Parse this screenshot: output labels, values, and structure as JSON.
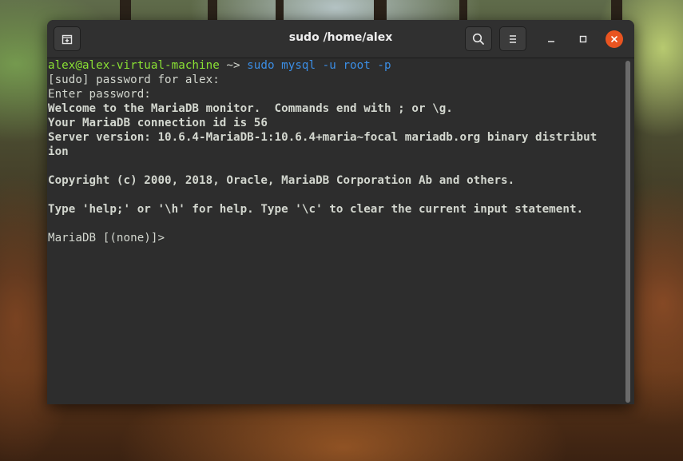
{
  "window": {
    "title": "sudo /home/alex"
  },
  "icons": {
    "new_tab": "new-tab-icon",
    "search": "search-icon",
    "menu": "hamburger-menu-icon",
    "minimize": "minimize-icon",
    "maximize": "maximize-icon",
    "close": "close-icon"
  },
  "colors": {
    "prompt_user": "#8ae234",
    "command": "#3b8ee5",
    "close_button": "#e95420",
    "terminal_bg": "#2d2d2d"
  },
  "terminal": {
    "prompt_user": "alex@alex-virtual-machine",
    "prompt_path": " ~> ",
    "command": "sudo mysql -u root -p",
    "lines": [
      "[sudo] password for alex:",
      "Enter password:",
      "Welcome to the MariaDB monitor.  Commands end with ; or \\g.",
      "Your MariaDB connection id is 56",
      "Server version: 10.6.4-MariaDB-1:10.6.4+maria~focal mariadb.org binary distribut",
      "ion",
      "",
      "Copyright (c) 2000, 2018, Oracle, MariaDB Corporation Ab and others.",
      "",
      "Type 'help;' or '\\h' for help. Type '\\c' to clear the current input statement.",
      "",
      "MariaDB [(none)]> "
    ]
  }
}
